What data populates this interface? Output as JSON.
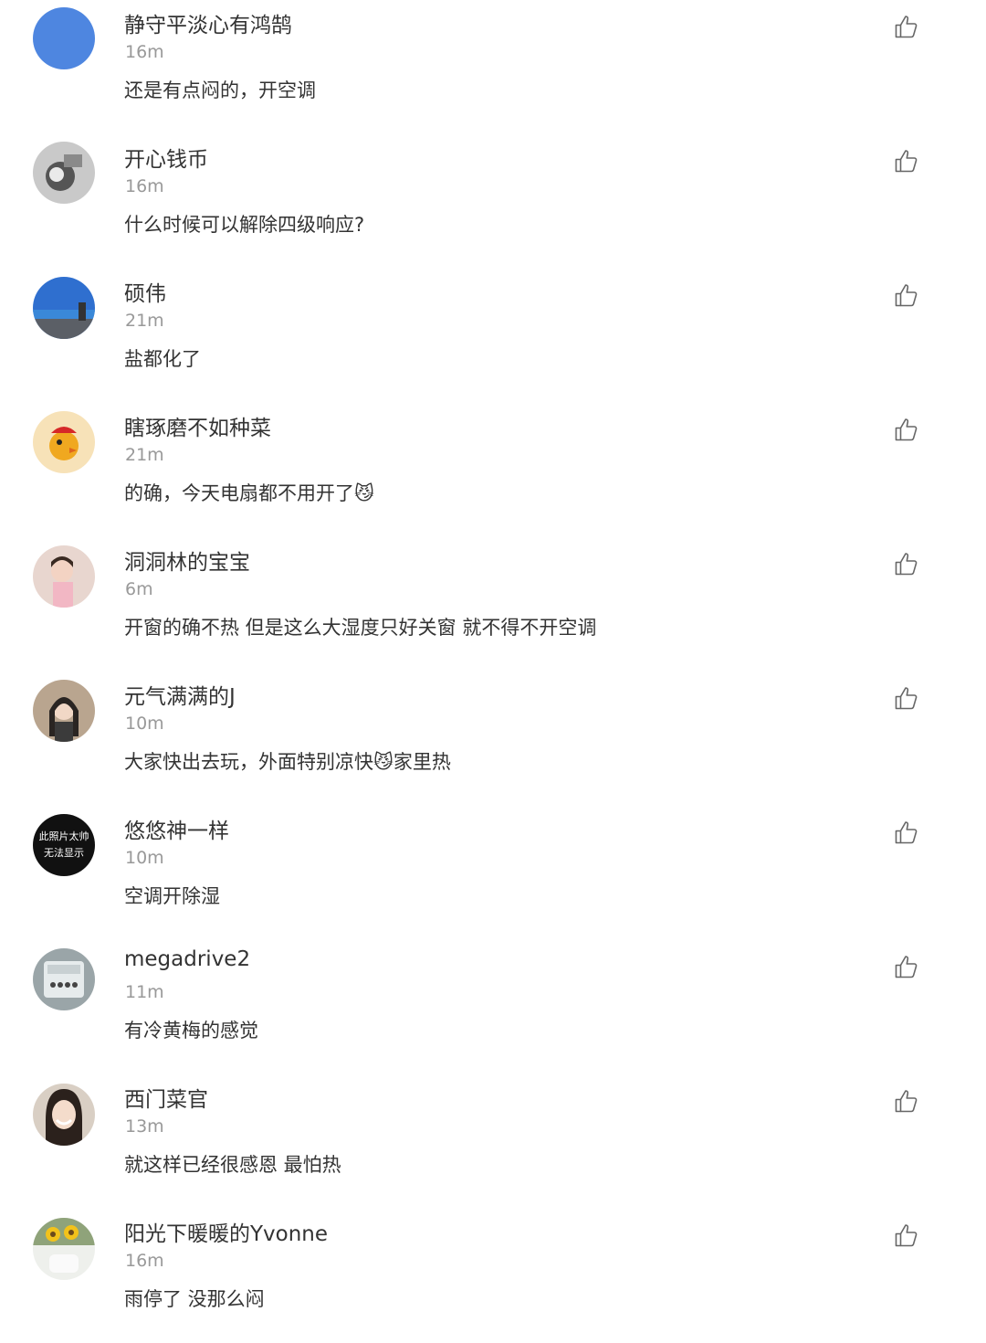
{
  "comments": [
    {
      "username": "静守平淡心有鸿鹄",
      "time": "16m",
      "text": "还是有点闷的，开空调",
      "avatar": "blue-solid-avatar",
      "like_icon": "thumbs-up-icon"
    },
    {
      "username": "开心钱币",
      "time": "16m",
      "text": "什么时候可以解除四级响应?",
      "avatar": "motorcycle-photo-avatar",
      "like_icon": "thumbs-up-icon"
    },
    {
      "username": "硕伟",
      "time": "21m",
      "text": "盐都化了",
      "avatar": "sky-landscape-avatar",
      "like_icon": "thumbs-up-icon"
    },
    {
      "username": "瞎琢磨不如种菜",
      "time": "21m",
      "text": "的确，今天电扇都不用开了",
      "emoji": "😼",
      "avatar": "cartoon-chick-avatar",
      "like_icon": "thumbs-up-icon"
    },
    {
      "username": "洞洞林的宝宝",
      "time": "6m",
      "text": "开窗的确不热 但是这么大湿度只好关窗 就不得不开空调",
      "avatar": "child-photo-avatar",
      "like_icon": "thumbs-up-icon"
    },
    {
      "username": "元气满满的J",
      "time": "10m",
      "text_before": "大家快出去玩，外面特别凉快",
      "emoji": "😼",
      "text_after": "家里热",
      "avatar": "girl-photo-avatar",
      "like_icon": "thumbs-up-icon"
    },
    {
      "username": "悠悠神一样",
      "time": "10m",
      "text": "空调开除湿",
      "avatar": "placeholder-avatar",
      "avatar_text_1": "此照片太帅",
      "avatar_text_2": "无法显示",
      "like_icon": "thumbs-up-icon"
    },
    {
      "username": "megadrive2",
      "time": "11m",
      "text": "有冷黄梅的感觉",
      "avatar": "console-photo-avatar",
      "like_icon": "thumbs-up-icon"
    },
    {
      "username": "西门菜官",
      "time": "13m",
      "text": "就这样已经很感恩 最怕热",
      "avatar": "woman-photo-avatar",
      "like_icon": "thumbs-up-icon"
    },
    {
      "username": "阳光下暖暖的Yvonne",
      "time": "16m",
      "text": "雨停了 没那么闷",
      "avatar": "sunflower-photo-avatar",
      "like_icon": "thumbs-up-icon"
    }
  ]
}
